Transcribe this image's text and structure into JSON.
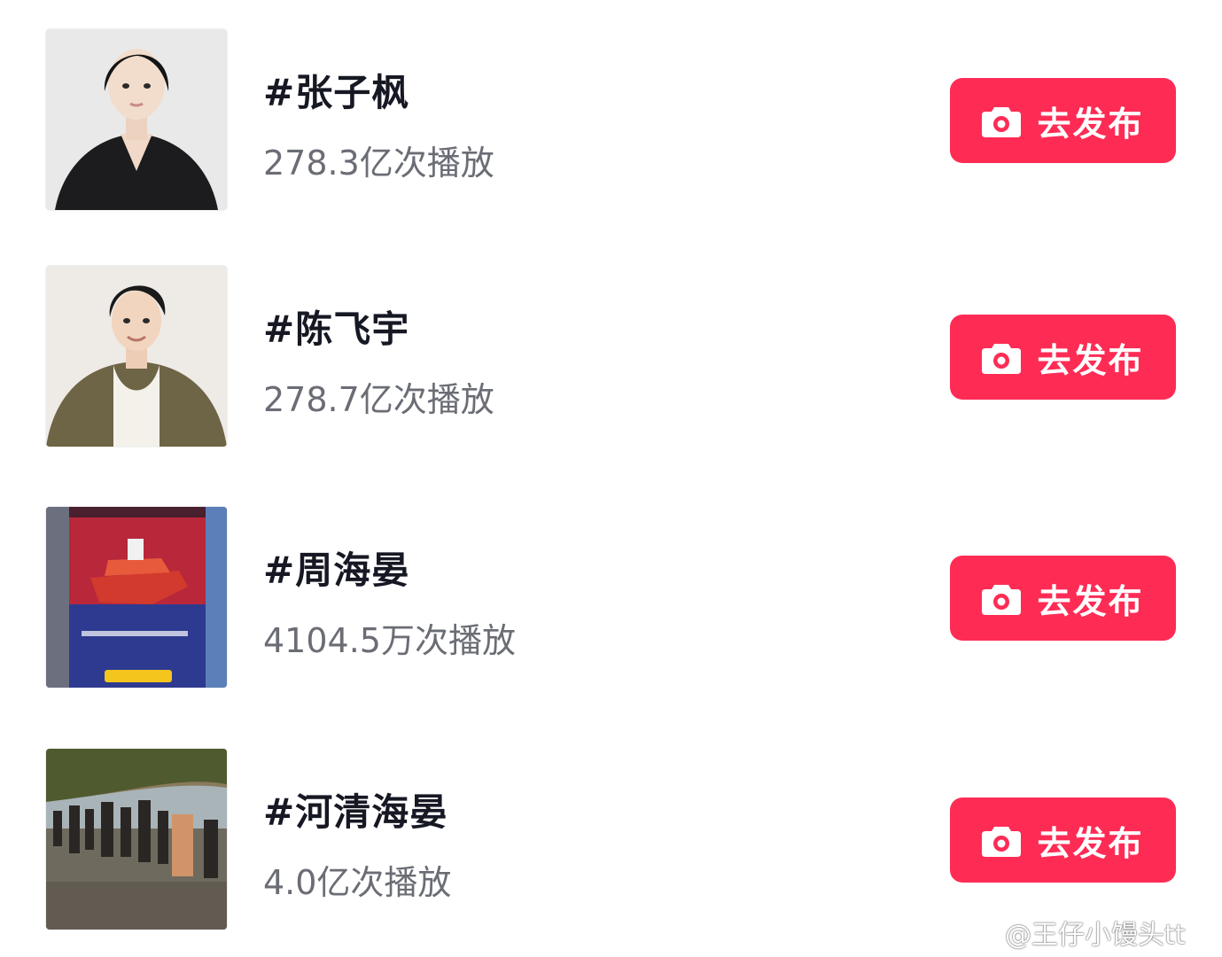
{
  "topics": [
    {
      "title": "#张子枫",
      "views": "278.3亿次播放",
      "button_label": "去发布",
      "thumbnail": "woman-portrait-black-blazer"
    },
    {
      "title": "#陈飞宇",
      "views": "278.7亿次播放",
      "button_label": "去发布",
      "thumbnail": "man-portrait-olive-jacket"
    },
    {
      "title": "#周海晏",
      "views": "4104.5万次播放",
      "button_label": "去发布",
      "thumbnail": "game-screenshot-red-boat"
    },
    {
      "title": "#河清海晏",
      "views": "4.0亿次播放",
      "button_label": "去发布",
      "thumbnail": "crowd-on-beach-sunset"
    }
  ],
  "watermark": {
    "text": "@王仔小馒头tt",
    "icon": "weibo-icon"
  },
  "colors": {
    "accent": "#fe2c55",
    "title": "#161823",
    "subtext": "#6b6d75"
  }
}
